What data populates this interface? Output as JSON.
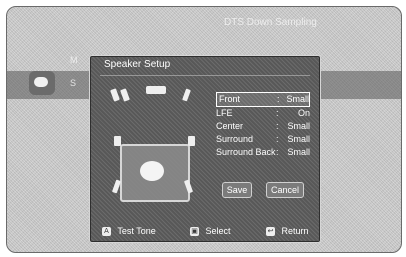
{
  "background": {
    "top_right_text": "DTS Down Sampling",
    "menu_letters": [
      "M",
      "S"
    ]
  },
  "dialog": {
    "title": "Speaker Setup",
    "settings": [
      {
        "label": "Front",
        "value": "Small"
      },
      {
        "label": "LFE",
        "value": "On"
      },
      {
        "label": "Center",
        "value": "Small"
      },
      {
        "label": "Surround",
        "value": "Small"
      },
      {
        "label": "Surround Back",
        "value": "Small"
      }
    ],
    "save_label": "Save",
    "cancel_label": "Cancel"
  },
  "footer": {
    "test_tone_key": "A",
    "test_tone_label": "Test Tone",
    "select_label": "Select",
    "return_label": "Return"
  },
  "colors": {
    "panel": "#5f5f5f",
    "text": "#ffffff",
    "highlight": "#ffffff"
  }
}
